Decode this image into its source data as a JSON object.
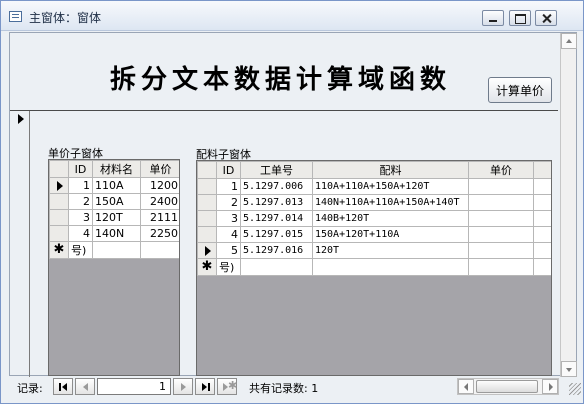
{
  "window": {
    "title": "主窗体：窗体"
  },
  "form": {
    "heading": "拆分文本数据计算域函数",
    "calc_button": "计算单价"
  },
  "unit_subform": {
    "label": "单价子窗体",
    "columns": [
      "ID",
      "材料名",
      "单价"
    ],
    "rows": [
      {
        "id": "1",
        "name": "110A",
        "price": "1200"
      },
      {
        "id": "2",
        "name": "150A",
        "price": "2400"
      },
      {
        "id": "3",
        "name": "120T",
        "price": "2111"
      },
      {
        "id": "4",
        "name": "140N",
        "price": "2250"
      }
    ],
    "new_row": "号)",
    "current_row": 1
  },
  "mix_subform": {
    "label": "配料子窗体",
    "columns": [
      "ID",
      "工单号",
      "配料",
      "单价"
    ],
    "rows": [
      {
        "id": "1",
        "order": "5.1297.006",
        "mix": "110A+110A+150A+120T",
        "price": ""
      },
      {
        "id": "2",
        "order": "5.1297.013",
        "mix": "140N+110A+110A+150A+140T",
        "price": ""
      },
      {
        "id": "3",
        "order": "5.1297.014",
        "mix": "140B+120T",
        "price": ""
      },
      {
        "id": "4",
        "order": "5.1297.015",
        "mix": "150A+120T+110A",
        "price": ""
      },
      {
        "id": "5",
        "order": "5.1297.016",
        "mix": "120T",
        "price": ""
      }
    ],
    "new_row": "号)",
    "current_row": 5
  },
  "navigation": {
    "label": "记录:",
    "current": "1",
    "total_label": "共有记录数: 1"
  }
}
